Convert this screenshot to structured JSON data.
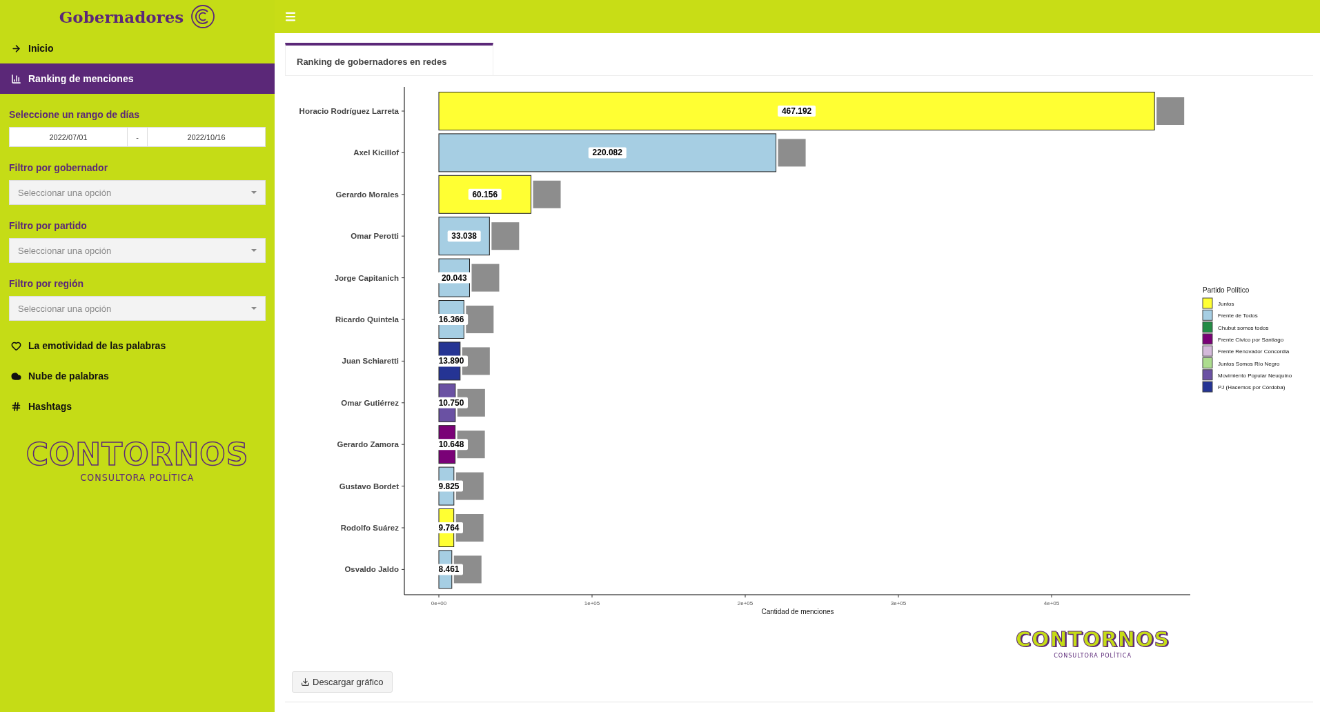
{
  "header": {
    "title": "Gobernadores"
  },
  "sidebar": {
    "menu_top": [
      {
        "label": "Inicio",
        "selected": false
      },
      {
        "label": "Ranking de menciones",
        "selected": true
      }
    ],
    "date_range": {
      "label": "Seleccione un rango de días",
      "start": "2022/07/01",
      "separator": "-",
      "end": "2022/10/16"
    },
    "filters": [
      {
        "label": "Filtro por gobernador",
        "placeholder": "Seleccionar una opción"
      },
      {
        "label": "Filtro por partido",
        "placeholder": "Seleccionar una opción"
      },
      {
        "label": "Filtro por región",
        "placeholder": "Seleccionar una opción"
      }
    ],
    "menu_bottom": [
      {
        "label": "La emotividad de las palabras",
        "selected": false
      },
      {
        "label": "Nube de palabras",
        "selected": false
      },
      {
        "label": "Hashtags",
        "selected": false
      }
    ],
    "logo": {
      "name": "CONTORNOS",
      "tagline": "CONSULTORA POLÍTICA"
    }
  },
  "tabs": [
    {
      "label": "Ranking de gobernadores en redes",
      "selected": true
    }
  ],
  "chart_data": {
    "type": "bar",
    "orientation": "horizontal",
    "xlabel": "Cantidad de menciones",
    "legend": {
      "title": "Partido Político"
    },
    "categories": [
      "Horacio Rodríguez Larreta",
      "Axel Kicillof",
      "Gerardo Morales",
      "Omar Perotti",
      "Jorge Capitanich",
      "Ricardo Quintela",
      "Juan Schiaretti",
      "Omar Gutiérrez",
      "Gerardo Zamora",
      "Gustavo Bordet",
      "Rodolfo Suárez",
      "Osvaldo Jaldo"
    ],
    "series": [
      {
        "name": "Juntos",
        "color": "#ffff33",
        "values": [
          467192,
          null,
          60156,
          null,
          null,
          null,
          null,
          null,
          null,
          null,
          9764,
          null
        ]
      },
      {
        "name": "Frente de Todos",
        "color": "#a6cee3",
        "values": [
          null,
          220082,
          null,
          33038,
          20043,
          16366,
          null,
          null,
          null,
          9825,
          null,
          8461
        ]
      },
      {
        "name": "Chubut somos todos",
        "color": "#238b45",
        "values": [
          null,
          null,
          null,
          null,
          null,
          null,
          null,
          null,
          null,
          null,
          null,
          null
        ]
      },
      {
        "name": "Frente Cívico por Santiago",
        "color": "#7a0177",
        "values": [
          null,
          null,
          null,
          null,
          null,
          null,
          null,
          null,
          10648,
          null,
          null,
          null
        ]
      },
      {
        "name": "Frente Renovador Concordia",
        "color": "#d4b9da",
        "values": [
          null,
          null,
          null,
          null,
          null,
          null,
          null,
          null,
          null,
          null,
          null,
          null
        ]
      },
      {
        "name": "Juntos Somos Río Negro",
        "color": "#addd8e",
        "values": [
          null,
          null,
          null,
          null,
          null,
          null,
          null,
          null,
          null,
          null,
          null,
          null
        ]
      },
      {
        "name": "Movimiento Popular Neuquino",
        "color": "#6a51a3",
        "values": [
          null,
          null,
          null,
          null,
          null,
          null,
          null,
          10750,
          null,
          null,
          null,
          null
        ]
      },
      {
        "name": "PJ (Hacemos por Córdoba)",
        "color": "#253494",
        "values": [
          null,
          null,
          null,
          null,
          null,
          null,
          13890,
          null,
          null,
          null,
          null,
          null
        ]
      }
    ],
    "value_labels": [
      "467.192",
      "220.082",
      "60.156",
      "33.038",
      "20.043",
      "16.366",
      "13.890",
      "10.750",
      "10.648",
      "9.825",
      "9.764",
      "8.461"
    ],
    "xlim": [
      -22523,
      490541
    ],
    "xticks": [
      {
        "value": 0,
        "label": "0e+00"
      },
      {
        "value": 100000,
        "label": "1e+05"
      },
      {
        "value": 200000,
        "label": "2e+05"
      },
      {
        "value": 300000,
        "label": "3e+05"
      },
      {
        "value": 400000,
        "label": "4e+05"
      }
    ]
  },
  "logo": {
    "name": "CONTORNOS",
    "tagline": "CONSULTORA POLÍTICA"
  },
  "download_button": {
    "label": "Descargar gráfico"
  }
}
